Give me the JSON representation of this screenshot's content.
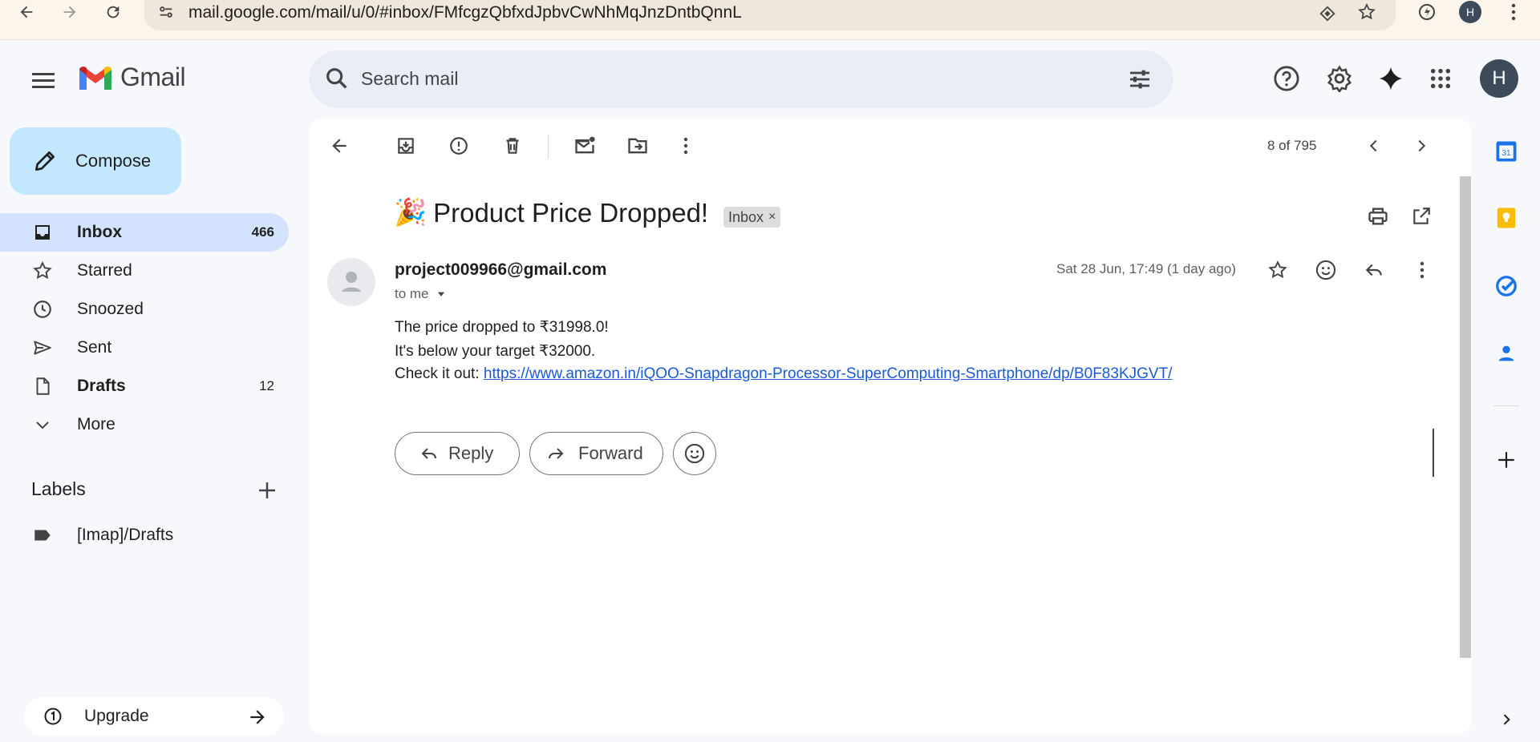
{
  "browser": {
    "url_host": "mail.google.com",
    "url_path": "/mail/u/0/#inbox/FMfcgzQbfxdJpbvCwNhMqJnzDntbQnnL",
    "profile_initial": "H"
  },
  "header": {
    "app_name": "Gmail",
    "search_placeholder": "Search mail",
    "avatar_initial": "H"
  },
  "sidebar": {
    "compose_label": "Compose",
    "items": [
      {
        "label": "Inbox",
        "count": "466",
        "active": true,
        "bold": true,
        "icon": "inbox-icon"
      },
      {
        "label": "Starred",
        "count": "",
        "icon": "star-icon"
      },
      {
        "label": "Snoozed",
        "count": "",
        "icon": "clock-icon"
      },
      {
        "label": "Sent",
        "count": "",
        "icon": "send-icon"
      },
      {
        "label": "Drafts",
        "count": "12",
        "bold": true,
        "icon": "draft-icon"
      },
      {
        "label": "More",
        "count": "",
        "icon": "chevron-down-icon"
      }
    ],
    "labels_heading": "Labels",
    "labels": [
      {
        "label": "[Imap]/Drafts",
        "icon": "label-icon"
      }
    ],
    "upgrade_label": "Upgrade"
  },
  "toolbar": {
    "pager": "8 of 795"
  },
  "message": {
    "emoji": "🎉",
    "subject": "Product Price Dropped!",
    "chip_label": "Inbox",
    "chip_close": "×",
    "sender": "project009966@gmail.com",
    "to_me": "to me",
    "date": "Sat 28 Jun, 17:49 (1 day ago)",
    "body": {
      "line1": "The price dropped to ₹31998.0!",
      "line2": "It's below your target ₹32000.",
      "line3_prefix": "Check it out: ",
      "link": "https://www.amazon.in/iQOO-Snapdragon-Processor-SuperComputing-Smartphone/dp/B0F83KJGVT/"
    },
    "reply_label": "Reply",
    "forward_label": "Forward"
  },
  "colors": {
    "compose_bg": "#c2e7ff",
    "active_nav": "#d3e3fd",
    "link": "#1a5ad8",
    "page_bg": "#f6f8fc"
  }
}
